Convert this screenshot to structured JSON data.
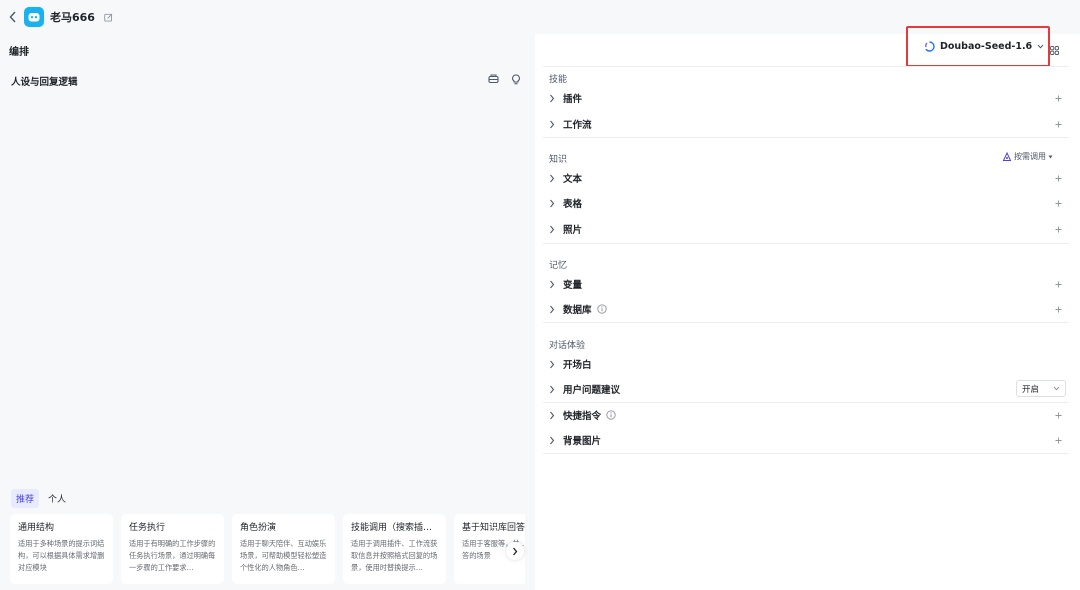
{
  "header": {
    "bot_name": "老马666"
  },
  "left": {
    "title": "编排",
    "prompt_title": "人设与回复逻辑",
    "template_tabs": [
      "推荐",
      "个人"
    ],
    "templates": [
      {
        "title": "通用结构",
        "desc": "适用于多种场景的提示词结构，可以根据具体需求增删对应模块"
      },
      {
        "title": "任务执行",
        "desc": "适用于有明确的工作步骤的任务执行场景，通过明确每一步骤的工作要求…"
      },
      {
        "title": "角色扮演",
        "desc": "适用于聊天陪伴、互动娱乐场景，可帮助模型轻松塑造个性化的人物角色…"
      },
      {
        "title": "技能调用（搜索插…",
        "desc": "适用于调用插件、工作流获取信息并按照格式回复的场景，使用时替换提示…"
      },
      {
        "title": "基于知识库回答",
        "desc": "适用于客服等，并…识库回答的场景"
      }
    ]
  },
  "right": {
    "model_name": "Doubao-Seed-1.6",
    "sections": {
      "skills": "技能",
      "knowledge": "知识",
      "memory": "记忆",
      "dialog": "对话体验"
    },
    "skills_items": [
      "插件",
      "工作流"
    ],
    "knowledge_mode": "按需调用",
    "knowledge_items": [
      "文本",
      "表格",
      "照片"
    ],
    "memory_items": [
      "变量",
      "数据库"
    ],
    "dialog_items": [
      "开场白",
      "用户问题建议",
      "快捷指令",
      "背景图片"
    ],
    "suggest_toggle": "开启"
  },
  "colors": {
    "accent": "#4e40e5",
    "highlight_border": "#e43a3a",
    "avatar": "#1ab2ee"
  }
}
